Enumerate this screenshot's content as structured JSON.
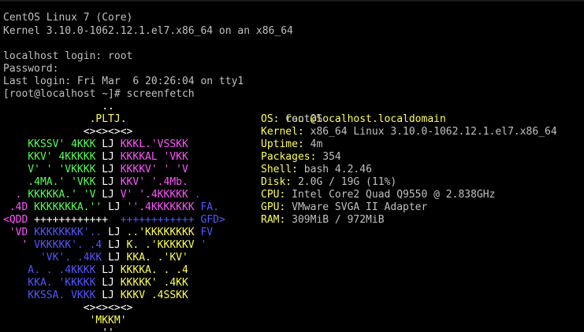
{
  "console": {
    "os_line": "CentOS Linux 7 (Core)",
    "kernel_line": "Kernel 3.10.0-1062.12.1.el7.x86_64 on an x86_64",
    "login_prompt": "localhost login: root",
    "password_prompt": "Password:",
    "last_login": "Last login: Fri Mar  6 20:26:04 on tty1",
    "shell_prompt": "[root@localhost ~]# screenfetch"
  },
  "colors": {
    "yellow": "#ffff55",
    "green": "#55ff55",
    "magenta": "#ff55ff",
    "blue": "#5555ff",
    "white": "#ffffff",
    "grey": "#c0c0c0"
  },
  "logo": [
    [
      {
        "t": "                ..",
        "c": "white"
      }
    ],
    [
      {
        "t": "              .PLTJ.",
        "c": "yellow"
      }
    ],
    [
      {
        "t": "             <><><><>",
        "c": "white"
      }
    ],
    [
      {
        "t": "    KKSSV' 4KKK ",
        "c": "green"
      },
      {
        "t": "LJ",
        "c": "white"
      },
      {
        "t": " KKKL.'VSSKK",
        "c": "magenta"
      }
    ],
    [
      {
        "t": "    KKV' 4KKKKK ",
        "c": "green"
      },
      {
        "t": "LJ",
        "c": "white"
      },
      {
        "t": " KKKKAL 'VKK",
        "c": "magenta"
      }
    ],
    [
      {
        "t": "    V' ' 'VKKKK ",
        "c": "green"
      },
      {
        "t": "LJ",
        "c": "white"
      },
      {
        "t": " KKKKV' ' 'V",
        "c": "magenta"
      }
    ],
    [
      {
        "t": "    .4MA.' 'VKK ",
        "c": "green"
      },
      {
        "t": "LJ",
        "c": "white"
      },
      {
        "t": " KKV' '.4Mb.",
        "c": "magenta"
      }
    ],
    [
      {
        "t": "  . ",
        "c": "magenta"
      },
      {
        "t": "KKKKKA.' 'V ",
        "c": "green"
      },
      {
        "t": "LJ",
        "c": "white"
      },
      {
        "t": " V' '.4KKKKK ",
        "c": "magenta"
      },
      {
        "t": ".",
        "c": "blue"
      }
    ],
    [
      {
        "t": " .4D ",
        "c": "magenta"
      },
      {
        "t": "KKKKKKKA.'' ",
        "c": "green"
      },
      {
        "t": "LJ",
        "c": "white"
      },
      {
        "t": " ''.4KKKKKKK ",
        "c": "magenta"
      },
      {
        "t": "FA.",
        "c": "blue"
      }
    ],
    [
      {
        "t": "<QDD ",
        "c": "magenta"
      },
      {
        "t": "++++++++++++  ",
        "c": "white"
      },
      {
        "t": "++++++++++++ ",
        "c": "blue"
      },
      {
        "t": "GFD>",
        "c": "blue"
      }
    ],
    [
      {
        "t": " 'VD ",
        "c": "magenta"
      },
      {
        "t": "KKKKKKKK'.. ",
        "c": "blue"
      },
      {
        "t": "LJ",
        "c": "white"
      },
      {
        "t": " ..'KKKKKKKK ",
        "c": "yellow"
      },
      {
        "t": "FV",
        "c": "blue"
      }
    ],
    [
      {
        "t": "   ' ",
        "c": "magenta"
      },
      {
        "t": "VKKKKK'. .4 ",
        "c": "blue"
      },
      {
        "t": "LJ",
        "c": "white"
      },
      {
        "t": " K. .'KKKKKV ",
        "c": "yellow"
      },
      {
        "t": "'",
        "c": "blue"
      }
    ],
    [
      {
        "t": "      'VK'. .4KK ",
        "c": "blue"
      },
      {
        "t": "LJ",
        "c": "white"
      },
      {
        "t": " KKA. .'KV'",
        "c": "yellow"
      }
    ],
    [
      {
        "t": "    A. . .4KKKK ",
        "c": "blue"
      },
      {
        "t": "LJ",
        "c": "white"
      },
      {
        "t": " KKKKA. . .4",
        "c": "yellow"
      }
    ],
    [
      {
        "t": "    KKA. 'KKKKK ",
        "c": "blue"
      },
      {
        "t": "LJ",
        "c": "white"
      },
      {
        "t": " KKKKK' .4KK",
        "c": "yellow"
      }
    ],
    [
      {
        "t": "    KKSSA. VKKK ",
        "c": "blue"
      },
      {
        "t": "LJ",
        "c": "white"
      },
      {
        "t": " KKKV .4SSKK",
        "c": "yellow"
      }
    ],
    [
      {
        "t": "             <><><><>",
        "c": "white"
      }
    ],
    [
      {
        "t": "              'MKKM'",
        "c": "yellow"
      }
    ],
    [
      {
        "t": "                ''",
        "c": "white"
      }
    ]
  ],
  "info": {
    "host": "root@localhost.localdomain",
    "rows": [
      {
        "key": "OS: ",
        "value": "CentOS"
      },
      {
        "key": "Kernel: ",
        "value": "x86_64 Linux 3.10.0-1062.12.1.el7.x86_64"
      },
      {
        "key": "Uptime: ",
        "value": "4m"
      },
      {
        "key": "Packages: ",
        "value": "354"
      },
      {
        "key": "Shell: ",
        "value": "bash 4.2.46"
      },
      {
        "key": "Disk: ",
        "value": "2.0G / 19G (11%)"
      },
      {
        "key": "CPU: ",
        "value": "Intel Core2 Quad Q9550 @ 2.838GHz"
      },
      {
        "key": "GPU: ",
        "value": "VMware SVGA II Adapter"
      },
      {
        "key": "RAM: ",
        "value": "309MiB / 972MiB"
      }
    ]
  }
}
